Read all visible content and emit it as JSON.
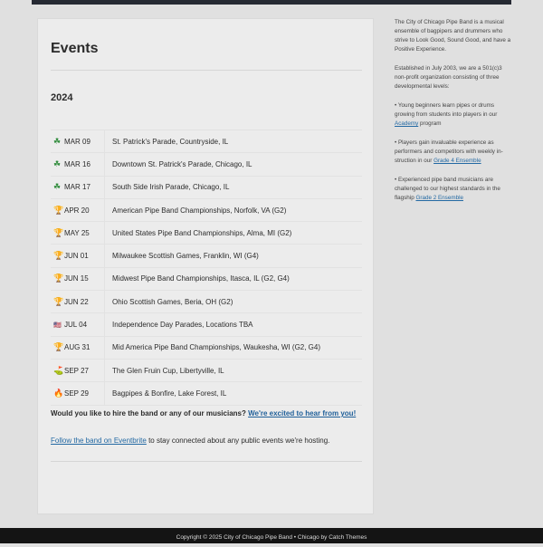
{
  "page": {
    "title": "Events",
    "year_heading": "2024"
  },
  "events": [
    {
      "icon": "shamrock-icon",
      "glyph": "☘",
      "icon_class": "shamrock",
      "date": "MAR 09",
      "name": "St. Patrick's Parade, Countryside, IL"
    },
    {
      "icon": "shamrock-icon",
      "glyph": "☘",
      "icon_class": "shamrock",
      "date": "MAR 16",
      "name": "Downtown St. Patrick's Parade, Chicago, IL"
    },
    {
      "icon": "shamrock-icon",
      "glyph": "☘",
      "icon_class": "shamrock",
      "date": "MAR 17",
      "name": "South Side Irish Parade, Chicago, IL"
    },
    {
      "icon": "trophy-icon",
      "glyph": "🏆",
      "icon_class": "trophy",
      "date": "APR 20",
      "name": "American Pipe Band Championships, Norfolk, VA (G2)"
    },
    {
      "icon": "trophy-icon",
      "glyph": "🏆",
      "icon_class": "trophy",
      "date": "MAY 25",
      "name": "United States Pipe Band Championships, Alma, MI (G2)"
    },
    {
      "icon": "trophy-icon",
      "glyph": "🏆",
      "icon_class": "trophy",
      "date": "JUN 01",
      "name": "Milwaukee Scottish Games, Franklin, WI (G4)"
    },
    {
      "icon": "trophy-icon",
      "glyph": "🏆",
      "icon_class": "trophy",
      "date": "JUN 15",
      "name": "Midwest Pipe Band Championships, Itasca, IL (G2, G4)"
    },
    {
      "icon": "trophy-icon",
      "glyph": "🏆",
      "icon_class": "trophy",
      "date": "JUN 22",
      "name": "Ohio Scottish Games, Beria, OH (G2)"
    },
    {
      "icon": "us-flag-icon",
      "glyph": "🇺🇸",
      "icon_class": "flag",
      "date": "JUL 04",
      "name": "Independence Day Parades, Locations TBA"
    },
    {
      "icon": "trophy-icon",
      "glyph": "🏆",
      "icon_class": "trophy",
      "date": "AUG 31",
      "name": "Mid America Pipe Band Championships, Waukesha, WI (G2, G4)"
    },
    {
      "icon": "golf-icon",
      "glyph": "⛳",
      "icon_class": "golf",
      "date": "SEP 27",
      "name": "The Glen Fruin Cup, Libertyville, IL"
    },
    {
      "icon": "fire-icon",
      "glyph": "🔥",
      "icon_class": "fire",
      "date": "SEP 29",
      "name": "Bagpipes & Bonfire, Lake Forest, IL"
    }
  ],
  "hire": {
    "text": "Would you like to hire the band or any of our musicians? ",
    "link": "We're excited to hear from you!"
  },
  "follow": {
    "link": "Follow the band on Eventbrite",
    "text": " to stay connected about any public events we're hosting."
  },
  "sidebar": {
    "intro": "The City of Chicago Pipe Band is a musical ensemble of bagpipers and drummers who strive to Look Good, Sound Good, and have a Positive Experience.",
    "established": "Established in July 2003, we are a 501(c)3 non-profit organization consisting of three developmental levels:",
    "level1_text": "• Young beginners learn pipes or drums growing from students into players in our ",
    "level1_link": "Academy",
    "level1_after": " program",
    "level2_text": "• Players gain invaluable experience as performers and competitors with weekly in­struction in our ",
    "level2_link": "Grade 4 Ensemble",
    "level3_text": "• Experienced pipe band musicians are challenged to our highest standards in the flagship ",
    "level3_link": "Grade 2 Ensemble"
  },
  "footer": {
    "text": "Copyright © 2025 City of Chicago Pipe Band • Chicago by Catch Themes"
  },
  "colors": {
    "page_bg": "#e0e0e0",
    "content_bg": "#ececec",
    "link": "#2369a3",
    "topbar": "#262a33",
    "footer_bg": "#141414"
  }
}
